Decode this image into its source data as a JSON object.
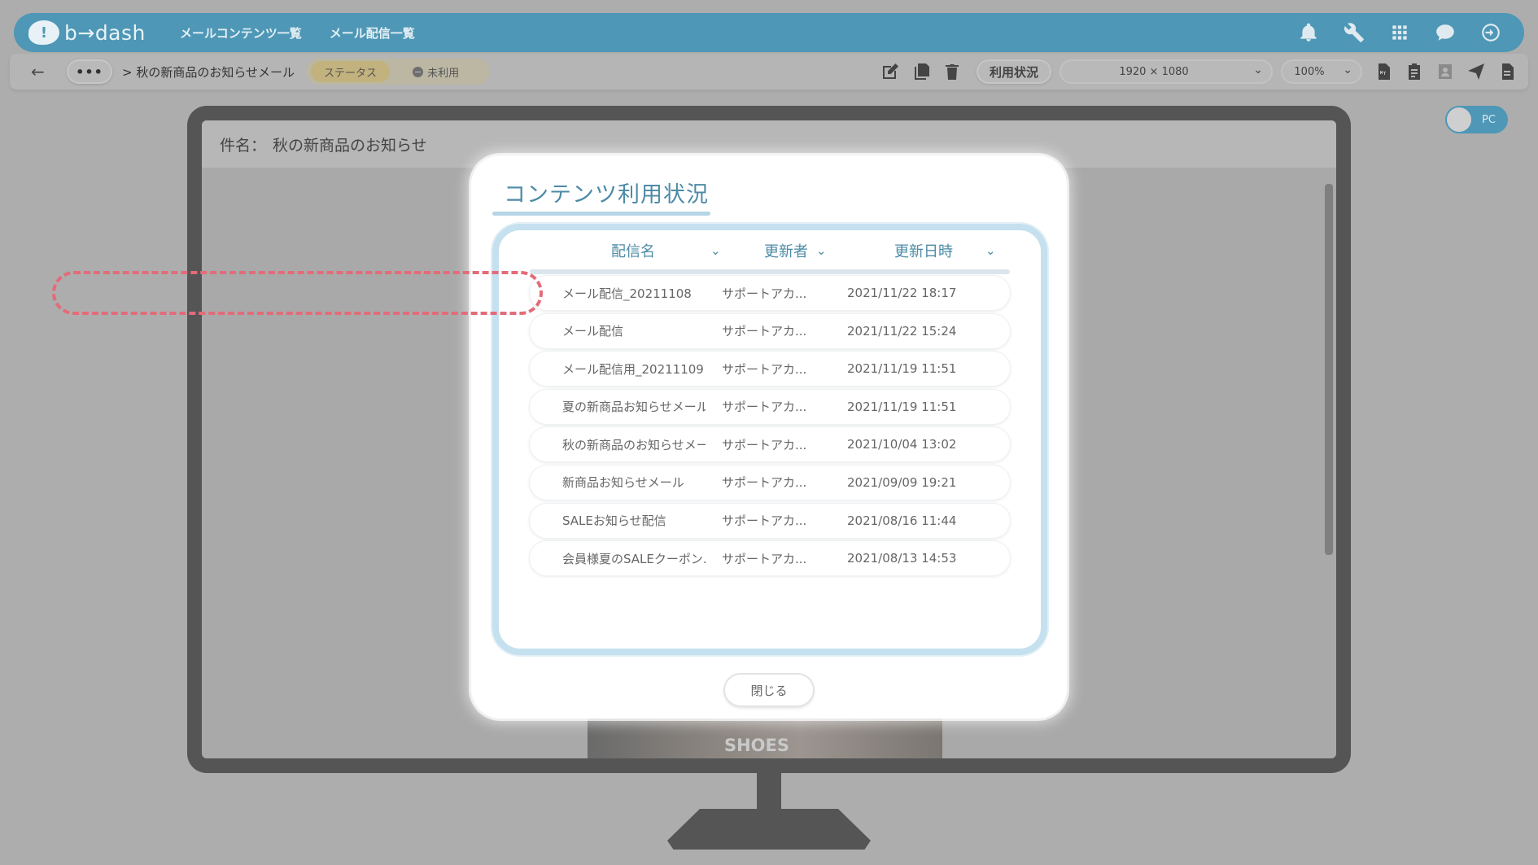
{
  "app": {
    "logo_text": "b→dash",
    "nav": [
      "メールコンテンツ一覧",
      "メール配信一覧"
    ]
  },
  "toolbar": {
    "more_label": "•••",
    "breadcrumb": "> 秋の新商品のお知らせメール",
    "status_label": "ステータス",
    "status_value": "未利用",
    "usage_button": "利用状況",
    "resolution": "1920 × 1080",
    "zoom": "100%"
  },
  "toggle": {
    "label": "PC"
  },
  "preview": {
    "subject_label": "件名：",
    "subject": "秋の新商品のお知らせ",
    "banner_text": "SHOES"
  },
  "modal": {
    "title": "コンテンツ利用状況",
    "columns": [
      "配信名",
      "更新者",
      "更新日時"
    ],
    "rows": [
      [
        "メール配信_20211108",
        "サポートアカ...",
        "2021/11/22 18:17"
      ],
      [
        "メール配信",
        "サポートアカ...",
        "2021/11/22 15:24"
      ],
      [
        "メール配信用_20211109",
        "サポートアカ...",
        "2021/11/19 11:51"
      ],
      [
        "夏の新商品お知らせメール",
        "サポートアカ...",
        "2021/11/19 11:51"
      ],
      [
        "秋の新商品のお知らせメール",
        "サポートアカ...",
        "2021/10/04 13:02"
      ],
      [
        "新商品お知らせメール",
        "サポートアカ...",
        "2021/09/09 19:21"
      ],
      [
        "SALEお知らせ配信",
        "サポートアカ...",
        "2021/08/16 11:44"
      ],
      [
        "会員様夏のSALEクーポン...",
        "サポートアカ...",
        "2021/08/13 14:53"
      ]
    ],
    "close_label": "閉じる"
  },
  "colors": {
    "brand": "#4e97b6",
    "highlight": "#e26c79",
    "frame": "#c5e0ee"
  }
}
